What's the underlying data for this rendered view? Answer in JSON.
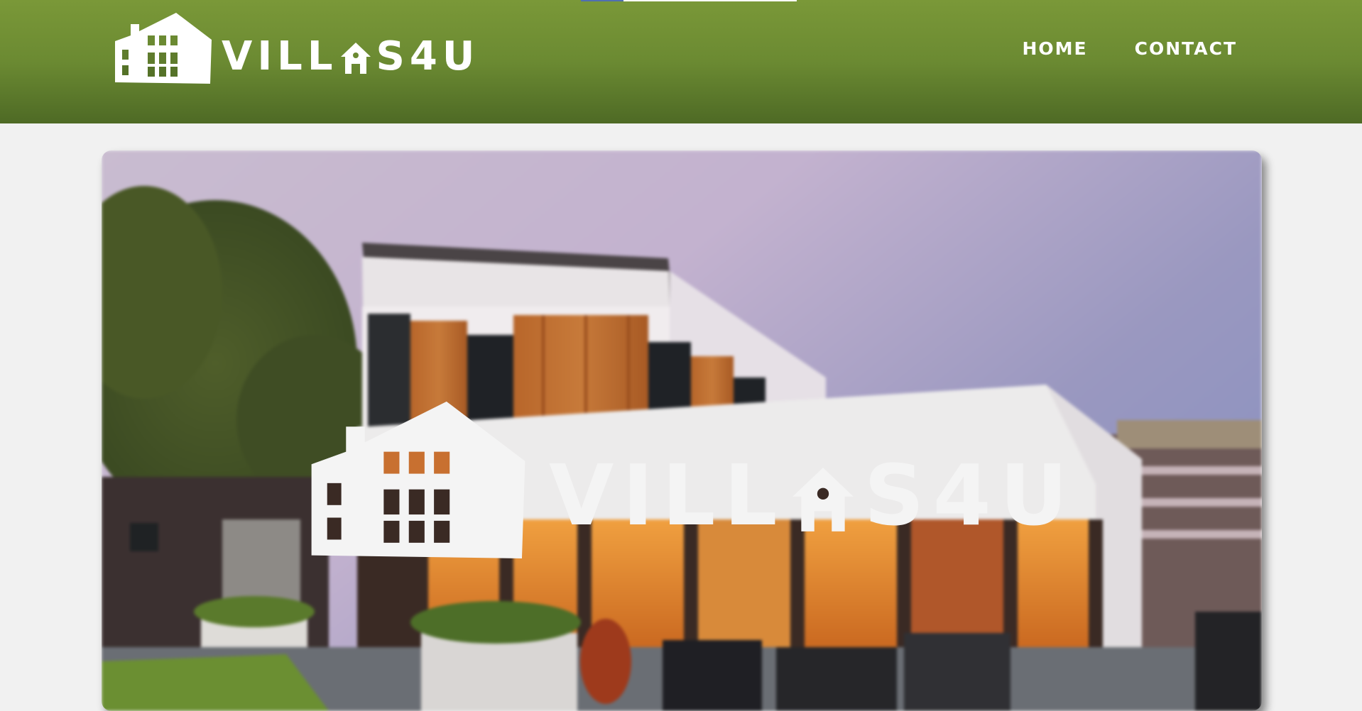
{
  "header": {
    "brand": {
      "part1": "VILL",
      "part2": "S4U",
      "logo_icon": "house-icon",
      "letter_icon": "house-a-icon"
    },
    "nav": [
      {
        "label": "HOME"
      },
      {
        "label": "CONTACT"
      }
    ]
  },
  "hero": {
    "brand": {
      "part1": "VILL",
      "part2": "S4U",
      "logo_icon": "house-icon",
      "letter_icon": "house-a-icon"
    },
    "image": "modern-villa-photo"
  },
  "colors": {
    "header_green": "#6b8a32",
    "header_green_dark": "#4e6a25",
    "page_bg": "#f1f1f1",
    "logo_white": "#ffffff"
  }
}
